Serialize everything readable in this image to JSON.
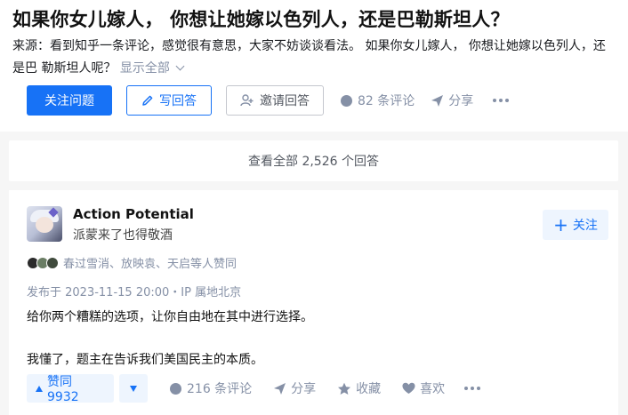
{
  "question": {
    "title": "如果你女儿嫁人， 你想让她嫁以色列人，还是巴勒斯坦人？",
    "description": "来源：看到知乎一条评论，感觉很有意思，大家不妨谈谈看法。 如果你女儿嫁人， 你想让她嫁以色列人，还是巴 勒斯坦人呢？",
    "show_all_label": "显示全部"
  },
  "question_actions": {
    "follow_question": "关注问题",
    "write_answer": "写回答",
    "invite_answer": "邀请回答",
    "comments": "82 条评论",
    "share": "分享"
  },
  "view_all_answers": "查看全部 2,526 个回答",
  "answer": {
    "author_name": "Action Potential",
    "author_bio": "派蒙来了也得敬酒",
    "follow_label": "关注",
    "voters_text": "春过雪消、放映袁、天启等人赞同",
    "meta": "发布于 2023-11-15 20:00・IP 属地北京",
    "paragraphs": [
      "给你两个糟糕的选项，让你自由地在其中进行选择。",
      "我懂了，题主在告诉我们美国民主的本质。"
    ],
    "upvote_label": "赞同 9932",
    "comments": "216 条评论",
    "share": "分享",
    "favorite": "收藏",
    "like": "喜欢"
  },
  "colors": {
    "accent": "#1772f6",
    "muted": "#8590a6",
    "accent_light": "#eef5fe"
  },
  "icons": [
    "pen-icon",
    "invite-user-icon",
    "comment-icon",
    "share-icon",
    "star-icon",
    "heart-icon",
    "more-icon",
    "plus-icon",
    "upvote-icon",
    "downvote-icon",
    "chevron-down-icon"
  ]
}
